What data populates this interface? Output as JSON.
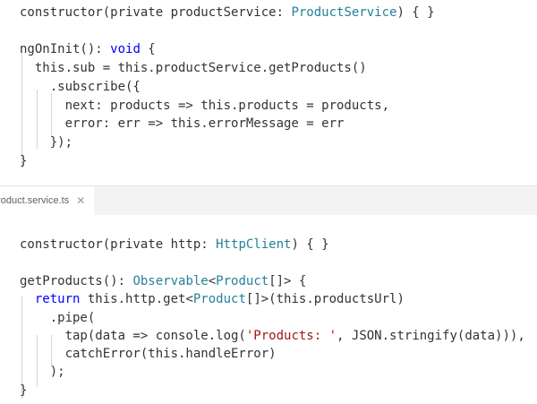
{
  "top_editor": {
    "lines": [
      [
        [
          "constructor(private productService: ",
          "ident"
        ],
        [
          "ProductService",
          "type"
        ],
        [
          ") { }",
          "punc"
        ]
      ],
      [],
      [
        [
          "ngOnInit(): ",
          "ident"
        ],
        [
          "void",
          "kw"
        ],
        [
          " {",
          "punc"
        ]
      ],
      [
        [
          "  this.sub = this.productService.getProducts()",
          "ident"
        ]
      ],
      [
        [
          "    .subscribe({",
          "ident"
        ]
      ],
      [
        [
          "      next: products => this.products = products,",
          "ident"
        ]
      ],
      [
        [
          "      error: err => this.errorMessage = err",
          "ident"
        ]
      ],
      [
        [
          "    });",
          "ident"
        ]
      ],
      [
        [
          "}",
          "punc"
        ]
      ]
    ]
  },
  "tab": {
    "label": "product.service.ts",
    "close_icon": "close-icon"
  },
  "bottom_editor": {
    "lines": [
      [],
      [
        [
          "constructor(private http: ",
          "ident"
        ],
        [
          "HttpClient",
          "type"
        ],
        [
          ") { }",
          "punc"
        ]
      ],
      [],
      [
        [
          "getProducts(): ",
          "ident"
        ],
        [
          "Observable",
          "type"
        ],
        [
          "<",
          "punc"
        ],
        [
          "Product",
          "type"
        ],
        [
          "[]> {",
          "punc"
        ]
      ],
      [
        [
          "  ",
          "ident"
        ],
        [
          "return",
          "kw"
        ],
        [
          " this.http.get<",
          "ident"
        ],
        [
          "Product",
          "type"
        ],
        [
          "[]>(this.productsUrl)",
          "ident"
        ]
      ],
      [
        [
          "    .pipe(",
          "ident"
        ]
      ],
      [
        [
          "      tap(data => console.log(",
          "ident"
        ],
        [
          "'Products: '",
          "str"
        ],
        [
          ", JSON.stringify(data))),",
          "ident"
        ]
      ],
      [
        [
          "      catchError(this.handleError)",
          "ident"
        ]
      ],
      [
        [
          "    );",
          "ident"
        ]
      ],
      [
        [
          "}",
          "punc"
        ]
      ]
    ]
  }
}
